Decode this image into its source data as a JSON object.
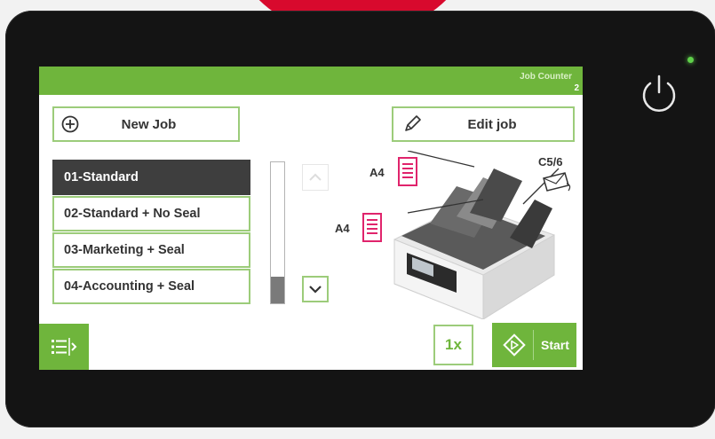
{
  "device": {
    "power_led_color": "#5fd04a",
    "icons": {
      "power": "power-icon"
    }
  },
  "header": {
    "job_counter_label": "Job Counter",
    "job_counter_value": "2",
    "accent_color": "#6fb53c"
  },
  "toolbar": {
    "new_job_label": "New Job",
    "new_job_icon": "plus-circle-icon",
    "edit_job_label": "Edit job",
    "edit_job_icon": "pencil-icon"
  },
  "job_list": {
    "items": [
      {
        "label": "01-Standard",
        "selected": true
      },
      {
        "label": "02-Standard + No Seal",
        "selected": false
      },
      {
        "label": "03-Marketing + Seal",
        "selected": false
      },
      {
        "label": "04-Accounting + Seal",
        "selected": false
      }
    ],
    "scroll_up_icon": "chevron-up-icon",
    "scroll_down_icon": "chevron-down-icon"
  },
  "machine": {
    "top_tray_paper": "A4",
    "lower_tray_paper": "A4",
    "envelope": "C5/6",
    "document_icon": "document-icon",
    "envelope_icon": "envelope-icon"
  },
  "footer": {
    "menu_icon": "list-menu-icon",
    "quantity_label": "1x",
    "start_label": "Start",
    "start_icon": "diamond-start-icon"
  }
}
